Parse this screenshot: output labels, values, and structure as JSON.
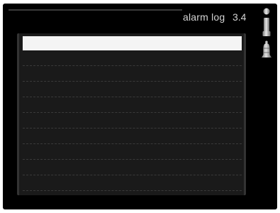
{
  "header": {
    "title": "alarm log",
    "menu_code": "3.4"
  },
  "icons": {
    "info": "info-icon",
    "alarm": "bell-icon"
  },
  "alarm_log": {
    "rows": [
      "",
      "",
      "",
      "",
      "",
      "",
      "",
      "",
      "",
      "",
      ""
    ],
    "selected_index": 0
  },
  "colors": {
    "screen_background": "#000000",
    "panel_background": "#1a1a1a",
    "selection_highlight": "#f4f4f4",
    "text": "#d4d4d4"
  }
}
